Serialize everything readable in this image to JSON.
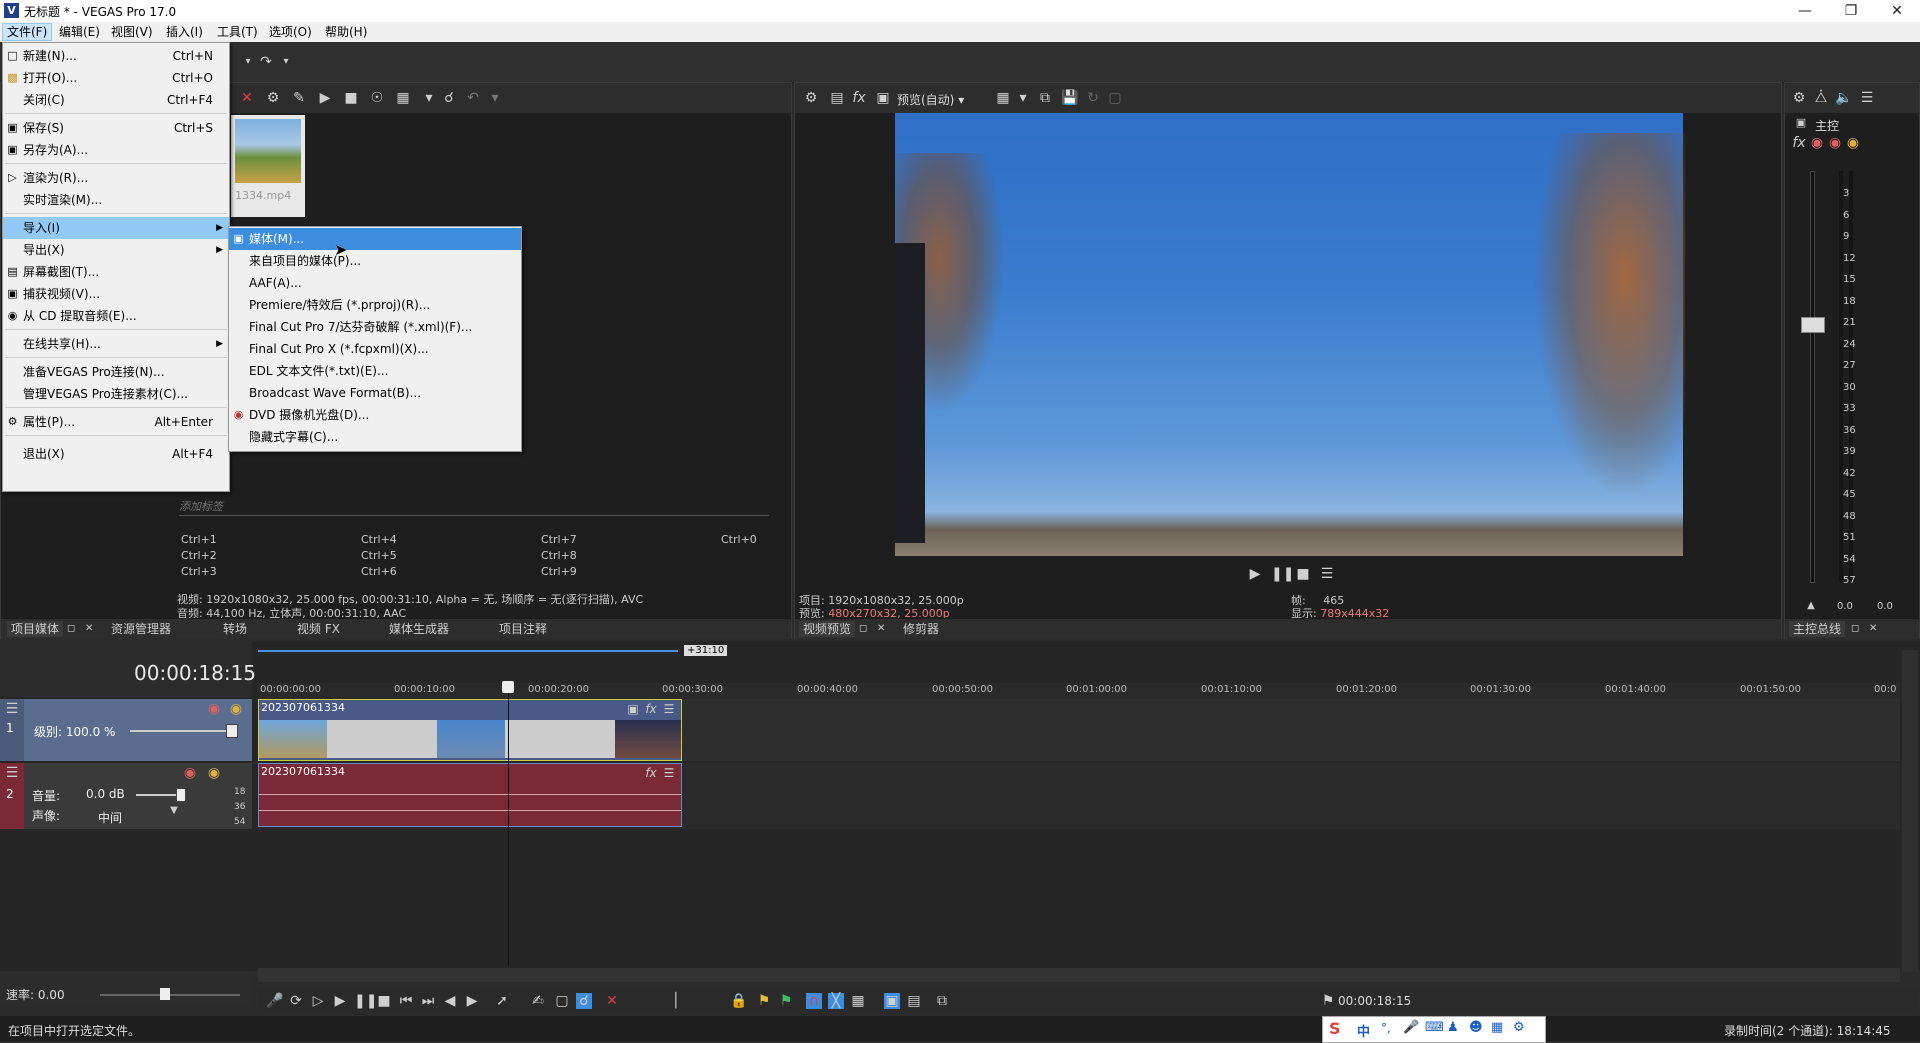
{
  "window": {
    "title": "无标题 * - VEGAS Pro 17.0",
    "app_icon": "V"
  },
  "menubar": {
    "items": [
      "文件(F)",
      "编辑(E)",
      "视图(V)",
      "插入(I)",
      "工具(T)",
      "选项(O)",
      "帮助(H)"
    ]
  },
  "file_menu": {
    "items": [
      {
        "label": "新建(N)...",
        "shortcut": "Ctrl+N"
      },
      {
        "label": "打开(O)...",
        "shortcut": "Ctrl+O"
      },
      {
        "label": "关闭(C)",
        "shortcut": "Ctrl+F4"
      },
      {
        "label": "保存(S)",
        "shortcut": "Ctrl+S"
      },
      {
        "label": "另存为(A)...",
        "shortcut": ""
      },
      {
        "label": "渲染为(R)...",
        "shortcut": ""
      },
      {
        "label": "实时渲染(M)...",
        "shortcut": ""
      },
      {
        "label": "导入(I)",
        "shortcut": ""
      },
      {
        "label": "导出(X)",
        "shortcut": ""
      },
      {
        "label": "屏幕截图(T)...",
        "shortcut": ""
      },
      {
        "label": "捕获视频(V)...",
        "shortcut": ""
      },
      {
        "label": "从 CD 提取音频(E)...",
        "shortcut": ""
      },
      {
        "label": "在线共享(H)...",
        "shortcut": ""
      },
      {
        "label": "准备VEGAS Pro连接(N)...",
        "shortcut": ""
      },
      {
        "label": "管理VEGAS Pro连接素材(C)...",
        "shortcut": ""
      },
      {
        "label": "属性(P)...",
        "shortcut": "Alt+Enter"
      },
      {
        "label": "退出(X)",
        "shortcut": "Alt+F4"
      }
    ]
  },
  "import_submenu": {
    "items": [
      "媒体(M)...",
      "来自项目的媒体(P)...",
      "AAF(A)...",
      "Premiere/特效后 (*.prproj)(R)...",
      "Final Cut Pro 7/达芬奇破解 (*.xml)(F)...",
      "Final Cut Pro X (*.fcpxml)(X)...",
      "EDL 文本文件(*.txt)(E)...",
      "Broadcast Wave Format(B)...",
      "DVD 摄像机光盘(D)...",
      "隐藏式字幕(C)..."
    ]
  },
  "project_media": {
    "thumb_label": "1334.mp4",
    "tag_placeholder": "添加标签",
    "shortcuts": [
      "Ctrl+1",
      "Ctrl+4",
      "Ctrl+7",
      "Ctrl+0",
      "Ctrl+2",
      "Ctrl+5",
      "Ctrl+8",
      "Ctrl+3",
      "Ctrl+6",
      "Ctrl+9"
    ],
    "video_info": "视频: 1920x1080x32, 25.000 fps, 00:00:31:10, Alpha = 无, 场顺序 = 无(逐行扫描), AVC",
    "audio_info": "音频: 44,100 Hz, 立体声, 00:00:31:10, AAC",
    "tabs": [
      "项目媒体",
      "资源管理器",
      "转场",
      "视频 FX",
      "媒体生成器",
      "项目注释"
    ]
  },
  "preview": {
    "mode_label": "预览(自动)",
    "project_label": "项目:",
    "project_value": "1920x1080x32, 25.000p",
    "preview_label": "预览:",
    "preview_value": "480x270x32, 25.000p",
    "frame_label": "帧:",
    "frame_value": "465",
    "display_label": "显示:",
    "display_value": "789x444x32",
    "tabs": [
      "视频预览",
      "修剪器"
    ]
  },
  "master_bus": {
    "title": "主控",
    "scale": [
      "3",
      "6",
      "9",
      "12",
      "15",
      "18",
      "21",
      "24",
      "27",
      "30",
      "33",
      "36",
      "39",
      "42",
      "45",
      "48",
      "51",
      "54",
      "57"
    ],
    "readout_left": "0.0",
    "readout_right": "0.0",
    "tab": "主控总线"
  },
  "timeline": {
    "timecode": "00:00:18:15",
    "offset_badge": "+31:10",
    "ruler": [
      "00:00:00:00",
      "00:00:10:00",
      "00:00:20:00",
      "00:00:30:00",
      "00:00:40:00",
      "00:00:50:00",
      "00:01:00:00",
      "00:01:10:00",
      "00:01:20:00",
      "00:01:30:00",
      "00:01:40:00",
      "00:01:50:00",
      "00:0"
    ],
    "video_track": {
      "number": "1",
      "level_label": "级别: 100.0 %",
      "clip_name": "202307061334"
    },
    "audio_track": {
      "number": "2",
      "volume_label": "音量:",
      "volume_value": "0.0 dB",
      "pan_label": "声像:",
      "pan_value": "中间",
      "clip_name": "202307061334",
      "db_marks": [
        "18",
        "36",
        "54"
      ]
    },
    "rate_label": "速率: 0.00",
    "transport_timecode": "00:00:18:15"
  },
  "statusbar": {
    "left": "在项目中打开选定文件。",
    "right": "录制时间(2 个通道): 18:14:45",
    "ime": "中"
  }
}
